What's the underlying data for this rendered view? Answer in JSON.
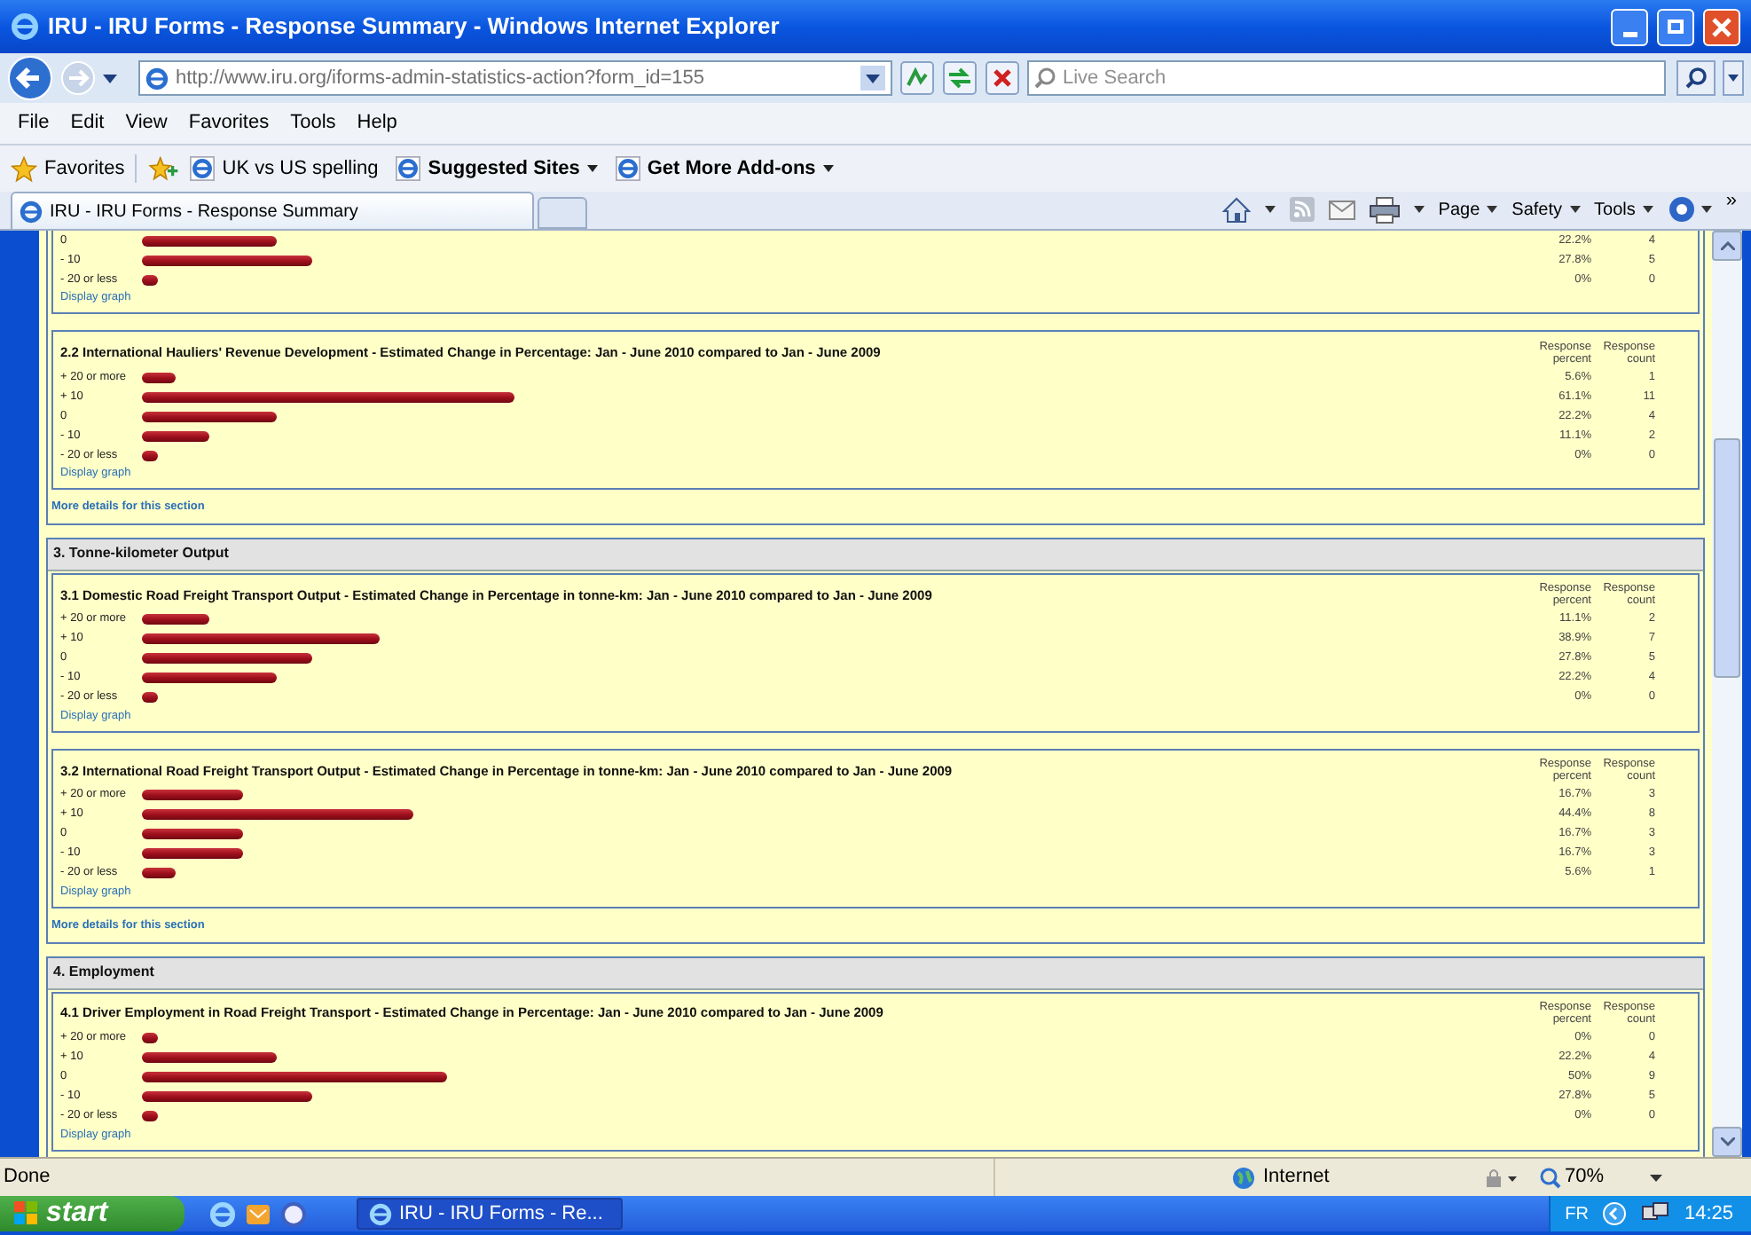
{
  "window": {
    "title": "IRU - IRU Forms - Response Summary - Windows Internet Explorer"
  },
  "address_bar": {
    "url": "http://www.iru.org/iforms-admin-statistics-action?form_id=155",
    "search_placeholder": "Live Search"
  },
  "menu": [
    "File",
    "Edit",
    "View",
    "Favorites",
    "Tools",
    "Help"
  ],
  "favorites_bar": {
    "label": "Favorites",
    "links": [
      {
        "label": "UK vs US spelling",
        "kind": "link"
      },
      {
        "label": "Suggested Sites",
        "kind": "dropdown"
      },
      {
        "label": "Get More Add-ons",
        "kind": "dropdown"
      }
    ]
  },
  "tab": {
    "title": "IRU - IRU Forms - Response Summary"
  },
  "command_bar": {
    "menus": [
      "Page",
      "Safety",
      "Tools"
    ],
    "overflow": "»"
  },
  "sections": [
    {
      "questions": [
        {
          "rows": [
            {
              "label": "0",
              "percent": "22.2%",
              "count": "4"
            },
            {
              "label": "- 10",
              "percent": "27.8%",
              "count": "5"
            },
            {
              "label": "- 20 or less",
              "percent": "0%",
              "count": "0"
            }
          ],
          "link": "Display graph"
        },
        {
          "title": "2.2 International Hauliers' Revenue Development - Estimated Change in Percentage: Jan - June 2010 compared to Jan - June 2009",
          "columns": [
            "Response percent",
            "Response count"
          ],
          "rows": [
            {
              "label": "+ 20 or more",
              "percent": "5.6%",
              "count": "1"
            },
            {
              "label": "+ 10",
              "percent": "61.1%",
              "count": "11"
            },
            {
              "label": "0",
              "percent": "22.2%",
              "count": "4"
            },
            {
              "label": "- 10",
              "percent": "11.1%",
              "count": "2"
            },
            {
              "label": "- 20 or less",
              "percent": "0%",
              "count": "0"
            }
          ],
          "link": "Display graph"
        }
      ],
      "more_link": "More details for this section"
    },
    {
      "title": "3. Tonne-kilometer Output",
      "questions": [
        {
          "title": "3.1 Domestic Road Freight Transport Output - Estimated Change in Percentage in tonne-km: Jan - June 2010 compared to Jan - June 2009",
          "columns": [
            "Response percent",
            "Response count"
          ],
          "rows": [
            {
              "label": "+ 20 or more",
              "percent": "11.1%",
              "count": "2"
            },
            {
              "label": "+ 10",
              "percent": "38.9%",
              "count": "7"
            },
            {
              "label": "0",
              "percent": "27.8%",
              "count": "5"
            },
            {
              "label": "- 10",
              "percent": "22.2%",
              "count": "4"
            },
            {
              "label": "- 20 or less",
              "percent": "0%",
              "count": "0"
            }
          ],
          "link": "Display graph"
        },
        {
          "title": "3.2 International Road Freight Transport Output - Estimated Change in Percentage in tonne-km: Jan - June 2010 compared to Jan - June 2009",
          "columns": [
            "Response percent",
            "Response count"
          ],
          "rows": [
            {
              "label": "+ 20 or more",
              "percent": "16.7%",
              "count": "3"
            },
            {
              "label": "+ 10",
              "percent": "44.4%",
              "count": "8"
            },
            {
              "label": "0",
              "percent": "16.7%",
              "count": "3"
            },
            {
              "label": "- 10",
              "percent": "16.7%",
              "count": "3"
            },
            {
              "label": "- 20 or less",
              "percent": "5.6%",
              "count": "1"
            }
          ],
          "link": "Display graph"
        }
      ],
      "more_link": "More details for this section"
    },
    {
      "title": "4. Employment",
      "questions": [
        {
          "title": "4.1 Driver Employment in Road Freight Transport - Estimated Change in Percentage: Jan - June 2010 compared to Jan - June 2009",
          "columns": [
            "Response percent",
            "Response count"
          ],
          "rows": [
            {
              "label": "+ 20 or more",
              "percent": "0%",
              "count": "0"
            },
            {
              "label": "+ 10",
              "percent": "22.2%",
              "count": "4"
            },
            {
              "label": "0",
              "percent": "50%",
              "count": "9"
            },
            {
              "label": "- 10",
              "percent": "27.8%",
              "count": "5"
            },
            {
              "label": "- 20 or less",
              "percent": "0%",
              "count": "0"
            }
          ],
          "link": "Display graph"
        }
      ]
    }
  ],
  "status_bar": {
    "text": "Done",
    "zone": "Internet",
    "zoom": "70%"
  },
  "taskbar": {
    "start": "start",
    "task": "IRU - IRU Forms - Re...",
    "language": "FR",
    "time": "14:25"
  }
}
